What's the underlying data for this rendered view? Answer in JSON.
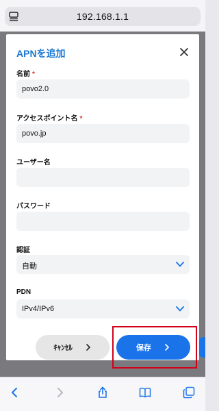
{
  "browser": {
    "url": "192.168.1.1"
  },
  "modal": {
    "title": "APNを追加",
    "fields": [
      {
        "label": "名前",
        "required": true,
        "value": "povo2.0"
      },
      {
        "label": "アクセスポイント名",
        "required": true,
        "value": "povo.jp"
      },
      {
        "label": "ユーザー名",
        "required": false,
        "value": ""
      },
      {
        "label": "パスワード",
        "required": false,
        "value": ""
      }
    ],
    "selects": [
      {
        "label": "認証",
        "value": "自動"
      },
      {
        "label": "PDN",
        "value": "IPv4/IPv6"
      }
    ],
    "required_mark": "*",
    "cancel_label": "ｷｬﾝｾﾙ",
    "save_label": "保存"
  },
  "colors": {
    "accent": "#1a73e8",
    "title": "#1976d2",
    "required": "#d32f2f",
    "highlight": "#d0021b"
  },
  "icons": [
    "page-menu-icon",
    "close-icon",
    "chevron-down-icon",
    "chevron-right-icon",
    "back-icon",
    "forward-icon",
    "share-icon",
    "bookmarks-icon",
    "tabs-icon"
  ]
}
